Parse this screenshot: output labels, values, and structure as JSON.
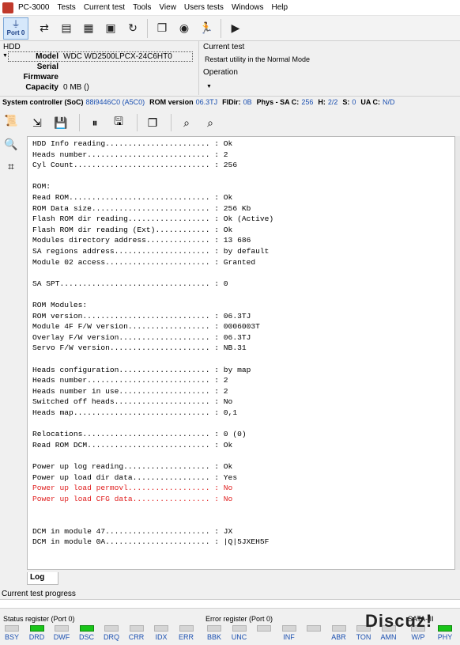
{
  "menu": {
    "app": "PC-3000",
    "items": [
      "Tests",
      "Current test",
      "Tools",
      "View",
      "Users tests",
      "Windows",
      "Help"
    ]
  },
  "toolbar": {
    "port_label": "Port 0"
  },
  "hdd": {
    "title": "HDD",
    "model_label": "Model",
    "model_value": "WDC WD2500LPCX-24C6HT0",
    "serial_label": "Serial",
    "serial_value": "",
    "firmware_label": "Firmware",
    "firmware_value": "",
    "capacity_label": "Capacity",
    "capacity_value": "0 MB ()"
  },
  "current_test": {
    "title": "Current test",
    "value": "Restart utility in the Normal Mode",
    "operation_label": "Operation"
  },
  "soc": {
    "label": "System controller (SoC)",
    "value": "88i9446C0 (A5C0)",
    "rom_label": "ROM version",
    "rom_value": "06.3TJ",
    "fidir_label": "FIDir:",
    "fidir_value": "0B",
    "phys_label": "Phys - SA C:",
    "phys_value": "256",
    "h_label": "H:",
    "h_value": "2/2",
    "s_label": "S:",
    "s_value": "0",
    "uac_label": "UA C:",
    "uac_value": "N/D"
  },
  "log": {
    "tab": "Log",
    "lines": [
      {
        "text": "HDD Info reading....................... : Ok",
        "color": "black"
      },
      {
        "text": "Heads number........................... : 2",
        "color": "black"
      },
      {
        "text": "Cyl Count.............................. : 256",
        "color": "black"
      },
      {
        "text": "",
        "color": "black"
      },
      {
        "text": "ROM:",
        "color": "black"
      },
      {
        "text": "Read ROM............................... : Ok",
        "color": "black"
      },
      {
        "text": "ROM Data size.......................... : 256 Kb",
        "color": "black"
      },
      {
        "text": "Flash ROM dir reading.................. : Ok (Active)",
        "color": "black"
      },
      {
        "text": "Flash ROM dir reading (Ext)............ : Ok",
        "color": "black"
      },
      {
        "text": "Modules directory address.............. : 13 686",
        "color": "black"
      },
      {
        "text": "SA regions address..................... : by default",
        "color": "black"
      },
      {
        "text": "Module 02 access....................... : Granted",
        "color": "black"
      },
      {
        "text": "",
        "color": "black"
      },
      {
        "text": "SA SPT................................. : 0",
        "color": "black"
      },
      {
        "text": "",
        "color": "black"
      },
      {
        "text": "ROM Modules:",
        "color": "black"
      },
      {
        "text": "ROM version............................ : 06.3TJ",
        "color": "black"
      },
      {
        "text": "Module 4F F/W version.................. : 0006003T",
        "color": "black"
      },
      {
        "text": "Overlay F/W version.................... : 06.3TJ",
        "color": "black"
      },
      {
        "text": "Servo F/W version...................... : NB.31",
        "color": "black"
      },
      {
        "text": "",
        "color": "black"
      },
      {
        "text": "Heads configuration.................... : by map",
        "color": "black"
      },
      {
        "text": "Heads number........................... : 2",
        "color": "black"
      },
      {
        "text": "Heads number in use.................... : 2",
        "color": "black"
      },
      {
        "text": "Switched off heads..................... : No",
        "color": "black"
      },
      {
        "text": "Heads map.............................. : 0,1",
        "color": "black"
      },
      {
        "text": "",
        "color": "black"
      },
      {
        "text": "Relocations............................ : 0 (0)",
        "color": "black"
      },
      {
        "text": "Read ROM DCM........................... : Ok",
        "color": "black"
      },
      {
        "text": "",
        "color": "black"
      },
      {
        "text": "Power up log reading................... : Ok",
        "color": "black"
      },
      {
        "text": "Power up load dir data................. : Yes",
        "color": "black"
      },
      {
        "text": "Power up load permovl.................. : No",
        "color": "red"
      },
      {
        "text": "Power up load CFG data................. : No",
        "color": "red"
      },
      {
        "text": "",
        "color": "black"
      },
      {
        "text": "",
        "color": "black"
      },
      {
        "text": "DCM in module 47....................... : JX",
        "color": "black"
      },
      {
        "text": "DCM in module 0A....................... : |Q|5JXEH5F",
        "color": "black"
      }
    ]
  },
  "progress": {
    "label": "Current test progress"
  },
  "status_register": {
    "title": "Status register (Port 0)",
    "leds": [
      {
        "name": "BSY",
        "on": false
      },
      {
        "name": "DRD",
        "on": true
      },
      {
        "name": "DWF",
        "on": false
      },
      {
        "name": "DSC",
        "on": true
      },
      {
        "name": "DRQ",
        "on": false
      },
      {
        "name": "CRR",
        "on": false
      },
      {
        "name": "IDX",
        "on": false
      },
      {
        "name": "ERR",
        "on": false
      }
    ]
  },
  "error_register": {
    "title": "Error register (Port 0)",
    "leds": [
      {
        "name": "BBK",
        "on": false
      },
      {
        "name": "UNC",
        "on": false
      },
      {
        "name": "",
        "on": false
      },
      {
        "name": "INF",
        "on": false
      },
      {
        "name": "",
        "on": false
      },
      {
        "name": "ABR",
        "on": false
      },
      {
        "name": "TON",
        "on": false
      },
      {
        "name": "AMN",
        "on": false
      }
    ]
  },
  "sata": {
    "title": "SATA-III",
    "leds": [
      {
        "name": "W/P",
        "on": false
      },
      {
        "name": "PHY",
        "on": true
      }
    ]
  },
  "watermark": "Discuz!"
}
